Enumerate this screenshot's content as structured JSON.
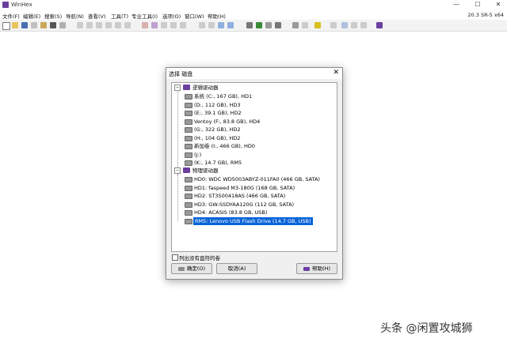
{
  "window": {
    "title": "WinHex",
    "version": "20.3 SR-5 x64",
    "controls": [
      "—",
      "☐",
      "✕"
    ]
  },
  "menubar": {
    "items": [
      "文件(F)",
      "编辑(E)",
      "搜索(S)",
      "导航(N)",
      "查看(V)",
      "工具(T)",
      "专业工具(I)",
      "选项(O)",
      "窗口(W)",
      "帮助(H)"
    ]
  },
  "dialog": {
    "title": "选择 磁盘",
    "close_label": "✕",
    "logical": {
      "label": "逻辑驱动器",
      "toggle": "−",
      "items": [
        "系统 (C:, 167 GB), HD1",
        "(D:, 112 GB), HD3",
        "(E:, 39.1 GB), HD2",
        "Ventoy (F:, 83.8 GB), HD4",
        "(G:, 322 GB), HD2",
        "(H:, 104 GB), HD2",
        "新加卷 (I:, 466 GB), HD0",
        "(J:)",
        "(K:, 14.7 GB), RM5"
      ]
    },
    "physical": {
      "label": "物理驱动器",
      "toggle": "−",
      "items": [
        "HD0: WDC WD5003ABYZ-011FA0 (466 GB, SATA)",
        "HD1: faspeed M3-180G (168 GB, SATA)",
        "HD2: ST3500418AS (466 GB, SATA)",
        "HD3: GW-SSDYAA120G (112 GB, SATA)",
        "HD4: ACASIS (83.8 GB, USB)",
        "RM5: Lenovo USB Flash Drive (14.7 GB, USB)"
      ],
      "selected_index": 5
    },
    "checkbox_label": "列出没有盘符的卷",
    "buttons": {
      "ok": "确定(O)",
      "cancel": "取消(A)",
      "help": "帮助(H)"
    }
  },
  "watermark": "头条 @闲置攻城狮",
  "colors": {
    "accent_purple": "#6b3fa0",
    "selection_blue": "#0a64d8"
  }
}
